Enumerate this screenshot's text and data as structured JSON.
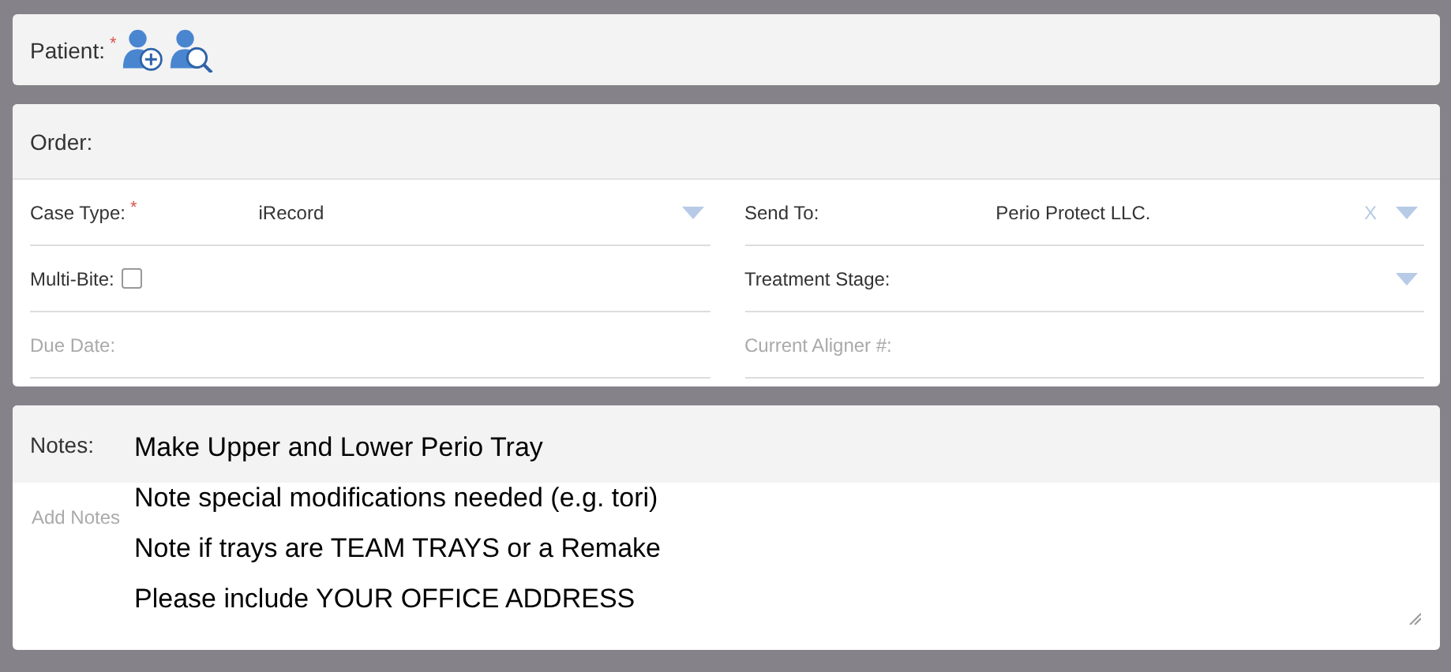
{
  "patient": {
    "label": "Patient:",
    "required_mark": "*"
  },
  "order": {
    "title": "Order:",
    "left_fields": [
      {
        "kind": "select",
        "label": "Case Type:",
        "required_mark": "*",
        "value": "iRecord",
        "disabled": false
      },
      {
        "kind": "checkbox",
        "label": "Multi-Bite:",
        "checked": false,
        "disabled": false
      },
      {
        "kind": "text",
        "label": "Due Date:",
        "disabled": true
      }
    ],
    "right_fields": [
      {
        "kind": "select",
        "label": "Send To:",
        "value": "Perio Protect LLC.",
        "clear": "X",
        "disabled": false
      },
      {
        "kind": "select",
        "label": "Treatment Stage:",
        "disabled": false
      },
      {
        "kind": "text",
        "label": "Current Aligner #:",
        "disabled": true
      }
    ]
  },
  "notes": {
    "label": "Notes:",
    "placeholder": "Add Notes",
    "lines": [
      "Make Upper and Lower Perio Tray",
      "Note special modifications needed (e.g. tori)",
      "Note if trays are TEAM TRAYS or a Remake",
      "Please include YOUR OFFICE ADDRESS"
    ]
  }
}
